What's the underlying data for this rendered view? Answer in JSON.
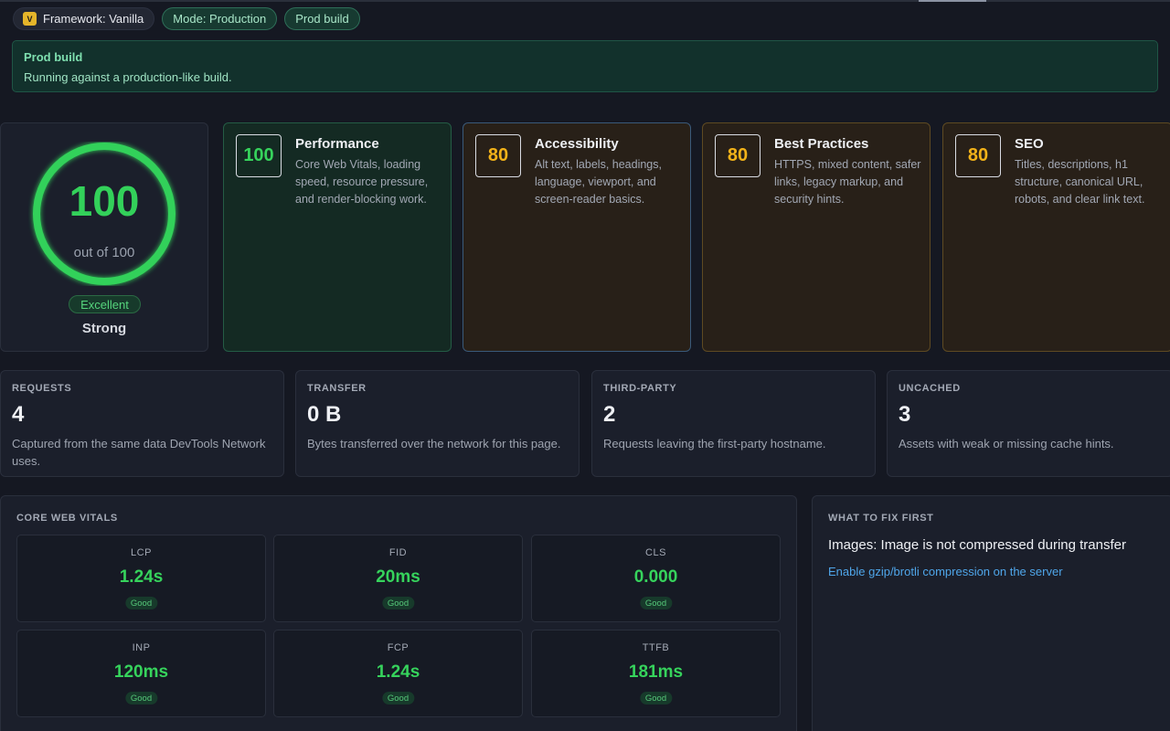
{
  "header": {
    "pills": {
      "framework_icon": "V",
      "framework": "Framework: Vanilla",
      "mode": "Mode: Production",
      "build": "Prod build"
    },
    "banner": {
      "title": "Prod build",
      "text": "Running against a production-like build."
    }
  },
  "score": {
    "value": "100",
    "out_of": "out of 100",
    "fraction": 1.0,
    "badge": "Excellent",
    "verdict": "Strong",
    "ring_color": "#33d15a"
  },
  "categories": [
    {
      "score": "100",
      "title": "Performance",
      "desc": "Core Web Vitals, loading speed, resource pressure, and render-blocking work."
    },
    {
      "score": "80",
      "title": "Accessibility",
      "desc": "Alt text, labels, headings, language, viewport, and screen-reader basics."
    },
    {
      "score": "80",
      "title": "Best Practices",
      "desc": "HTTPS, mixed content, safer links, legacy markup, and security hints."
    },
    {
      "score": "80",
      "title": "SEO",
      "desc": "Titles, descriptions, h1 structure, canonical URL, robots, and clear link text."
    }
  ],
  "stats": [
    {
      "label": "REQUESTS",
      "value": "4",
      "desc": "Captured from the same data DevTools Network uses."
    },
    {
      "label": "TRANSFER",
      "value": "0 B",
      "desc": "Bytes transferred over the network for this page."
    },
    {
      "label": "THIRD-PARTY",
      "value": "2",
      "desc": "Requests leaving the first-party hostname."
    },
    {
      "label": "UNCACHED",
      "value": "3",
      "desc": "Assets with weak or missing cache hints."
    }
  ],
  "vitals": {
    "label": "CORE WEB VITALS",
    "items": [
      {
        "name": "LCP",
        "value": "1.24s",
        "status": "Good"
      },
      {
        "name": "FID",
        "value": "20ms",
        "status": "Good"
      },
      {
        "name": "CLS",
        "value": "0.000",
        "status": "Good"
      },
      {
        "name": "INP",
        "value": "120ms",
        "status": "Good"
      },
      {
        "name": "FCP",
        "value": "1.24s",
        "status": "Good"
      },
      {
        "name": "TTFB",
        "value": "181ms",
        "status": "Good"
      }
    ]
  },
  "fix_first": {
    "label": "WHAT TO FIX FIRST",
    "title": "Images: Image is not compressed during transfer",
    "action": "Enable gzip/brotli compression on the server"
  }
}
